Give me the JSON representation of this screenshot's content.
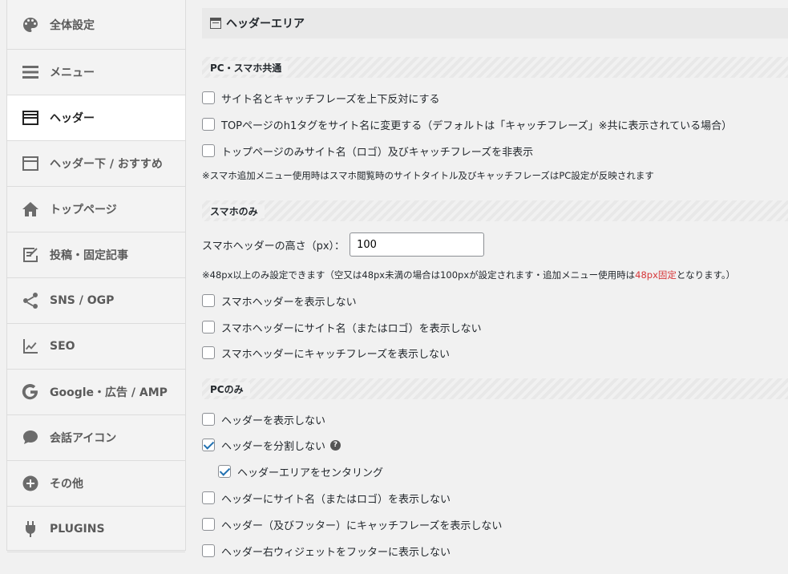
{
  "sidebar": {
    "items": [
      {
        "label": "全体設定",
        "icon": "palette-icon"
      },
      {
        "label": "メニュー",
        "icon": "menu-icon"
      },
      {
        "label": "ヘッダー",
        "icon": "header-icon"
      },
      {
        "label": "ヘッダー下 / おすすめ",
        "icon": "header-below-icon"
      },
      {
        "label": "トップページ",
        "icon": "home-icon"
      },
      {
        "label": "投稿・固定記事",
        "icon": "edit-icon"
      },
      {
        "label": "SNS / OGP",
        "icon": "share-icon"
      },
      {
        "label": "SEO",
        "icon": "chart-line-icon"
      },
      {
        "label": "Google・広告 / AMP",
        "icon": "google-icon"
      },
      {
        "label": "会話アイコン",
        "icon": "chat-icon"
      },
      {
        "label": "その他",
        "icon": "plus-circle-icon"
      },
      {
        "label": "PLUGINS",
        "icon": "plug-icon"
      }
    ],
    "active_index": 2
  },
  "main": {
    "title": "ヘッダーエリア",
    "sections": {
      "common": {
        "heading": "PC・スマホ共通",
        "options": [
          {
            "label": "サイト名とキャッチフレーズを上下反対にする",
            "checked": false
          },
          {
            "label": "TOPページのh1タグをサイト名に変更する（デフォルトは「キャッチフレーズ」※共に表示されている場合）",
            "checked": false
          },
          {
            "label": "トップページのみサイト名（ロゴ）及びキャッチフレーズを非表示",
            "checked": false
          }
        ],
        "note": "※スマホ追加メニュー使用時はスマホ閲覧時のサイトタイトル及びキャッチフレーズはPC設定が反映されます"
      },
      "sp": {
        "heading": "スマホのみ",
        "height_label": "スマホヘッダーの高さ（px）：",
        "height_value": "100",
        "note_prefix": "※48px以上のみ設定できます（空又は48px未満の場合は100pxが設定されます・追加メニュー使用時は",
        "note_red": "48px固定",
        "note_suffix": "となります。）",
        "options": [
          {
            "label": "スマホヘッダーを表示しない",
            "checked": false
          },
          {
            "label": "スマホヘッダーにサイト名（またはロゴ）を表示しない",
            "checked": false
          },
          {
            "label": "スマホヘッダーにキャッチフレーズを表示しない",
            "checked": false
          }
        ]
      },
      "pc": {
        "heading": "PCのみ",
        "options": [
          {
            "label": "ヘッダーを表示しない",
            "checked": false
          },
          {
            "label": "ヘッダーを分割しない",
            "checked": true
          },
          {
            "label": "ヘッダーエリアをセンタリング",
            "checked": true
          },
          {
            "label": "ヘッダーにサイト名（またはロゴ）を表示しない",
            "checked": false
          },
          {
            "label": "ヘッダー（及びフッター）にキャッチフレーズを表示しない",
            "checked": false
          },
          {
            "label": "ヘッダー右ウィジェットをフッターに表示しない",
            "checked": false
          }
        ],
        "help_glyph": "?"
      }
    }
  }
}
